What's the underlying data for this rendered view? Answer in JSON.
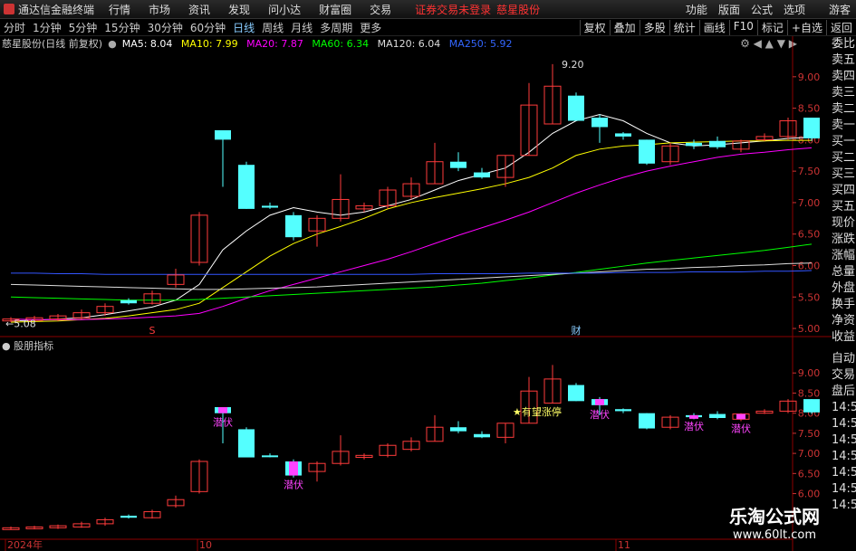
{
  "menubar": {
    "app_title": "通达信金融终端",
    "menus": [
      "行情",
      "市场",
      "资讯",
      "发现",
      "问小达",
      "财富圈",
      "交易"
    ],
    "warning": "证券交易未登录",
    "stock_name": "慈星股份",
    "right_menus": [
      "功能",
      "版面",
      "公式",
      "选项"
    ],
    "user": "游客"
  },
  "periods": {
    "items": [
      "分时",
      "1分钟",
      "5分钟",
      "15分钟",
      "30分钟",
      "60分钟",
      "日线",
      "周线",
      "月线",
      "多周期",
      "更多"
    ],
    "active": "日线",
    "tools": [
      "复权",
      "叠加",
      "多股",
      "统计",
      "画线",
      "F10",
      "标记",
      "+自选",
      "返回"
    ]
  },
  "title": {
    "stock": "慈星股份(日线 前复权)",
    "ma": [
      {
        "label": "MA5: 8.04",
        "color": "#ffffff"
      },
      {
        "label": "MA10: 7.99",
        "color": "#ffff00"
      },
      {
        "label": "MA20: 7.87",
        "color": "#ff00ff"
      },
      {
        "label": "MA60: 6.34",
        "color": "#00ff00"
      },
      {
        "label": "MA120: 6.04",
        "color": "#dddddd"
      },
      {
        "label": "MA250: 5.92",
        "color": "#3355ff"
      }
    ]
  },
  "right_panel": {
    "top": [
      "委比",
      "卖五",
      "卖四",
      "卖三",
      "卖二",
      "卖一",
      "买一",
      "买二",
      "买三",
      "买四",
      "买五",
      "现价",
      "涨跌",
      "涨幅",
      "总量",
      "外盘",
      "换手",
      "净资",
      "收益"
    ],
    "bottom": [
      "自动",
      "交易",
      "盘后",
      "14:56",
      "14:56",
      "14:56",
      "14:56",
      "14:56",
      "14:56",
      "14:56"
    ]
  },
  "main_axis": {
    "ticks": [
      "9.00",
      "8.50",
      "8.00",
      "7.50",
      "7.00",
      "6.50",
      "6.00",
      "5.50",
      "5.00"
    ]
  },
  "sub_axis": {
    "ticks": [
      "9.00",
      "8.50",
      "8.00",
      "7.50",
      "7.00",
      "6.50",
      "6.00"
    ]
  },
  "annotations": {
    "high": "9.20",
    "low": "5.08",
    "marker_s": "S",
    "marker_cai": "财",
    "ambush": "潜伏",
    "hope": "★有望涨停"
  },
  "sub_indicator": "股朋指标",
  "date_axis": [
    "2024年",
    "10",
    "11"
  ],
  "watermark": {
    "big": "乐淘公式网",
    "small": "www.60lt.com"
  },
  "chart_data": {
    "type": "candlestick",
    "title": "慈星股份(日线 前复权)",
    "candles": [
      {
        "o": 5.12,
        "c": 5.15,
        "h": 5.18,
        "l": 5.1
      },
      {
        "o": 5.13,
        "c": 5.17,
        "h": 5.2,
        "l": 5.11
      },
      {
        "o": 5.15,
        "c": 5.2,
        "h": 5.23,
        "l": 5.12
      },
      {
        "o": 5.17,
        "c": 5.25,
        "h": 5.3,
        "l": 5.15
      },
      {
        "o": 5.25,
        "c": 5.35,
        "h": 5.4,
        "l": 5.2
      },
      {
        "o": 5.4,
        "c": 5.45,
        "h": 5.48,
        "l": 5.38,
        "up": false
      },
      {
        "o": 5.4,
        "c": 5.55,
        "h": 5.6,
        "l": 5.38
      },
      {
        "o": 5.7,
        "c": 5.85,
        "h": 5.95,
        "l": 5.65
      },
      {
        "o": 6.05,
        "c": 6.8,
        "h": 6.85,
        "l": 6.0
      },
      {
        "o": 8.15,
        "c": 8.0,
        "h": 8.15,
        "l": 7.25,
        "up": false
      },
      {
        "o": 7.6,
        "c": 6.9,
        "h": 7.65,
        "l": 6.9,
        "up": false
      },
      {
        "o": 6.95,
        "c": 6.92,
        "h": 7.0,
        "l": 6.9,
        "up": false
      },
      {
        "o": 6.8,
        "c": 6.45,
        "h": 6.85,
        "l": 6.4,
        "up": false
      },
      {
        "o": 6.55,
        "c": 6.75,
        "h": 6.8,
        "l": 6.3
      },
      {
        "o": 6.75,
        "c": 7.05,
        "h": 7.45,
        "l": 6.7
      },
      {
        "o": 6.9,
        "c": 6.95,
        "h": 7.0,
        "l": 6.85
      },
      {
        "o": 6.95,
        "c": 7.2,
        "h": 7.25,
        "l": 6.9
      },
      {
        "o": 7.1,
        "c": 7.3,
        "h": 7.4,
        "l": 7.05
      },
      {
        "o": 7.3,
        "c": 7.65,
        "h": 7.95,
        "l": 7.3
      },
      {
        "o": 7.65,
        "c": 7.55,
        "h": 7.8,
        "l": 7.5,
        "up": false
      },
      {
        "o": 7.48,
        "c": 7.4,
        "h": 7.55,
        "l": 7.38,
        "up": false
      },
      {
        "o": 7.4,
        "c": 7.75,
        "h": 7.75,
        "l": 7.25
      },
      {
        "o": 7.75,
        "c": 8.55,
        "h": 8.9,
        "l": 7.75
      },
      {
        "o": 8.25,
        "c": 8.85,
        "h": 9.2,
        "l": 8.25
      },
      {
        "o": 8.7,
        "c": 8.3,
        "h": 8.75,
        "l": 8.3,
        "up": false
      },
      {
        "o": 8.35,
        "c": 8.2,
        "h": 8.4,
        "l": 7.95,
        "up": false
      },
      {
        "o": 8.1,
        "c": 8.05,
        "h": 8.12,
        "l": 8.0
      },
      {
        "o": 8.0,
        "c": 7.62,
        "h": 8.0,
        "l": 7.6,
        "up": false
      },
      {
        "o": 7.65,
        "c": 7.9,
        "h": 7.95,
        "l": 7.6
      },
      {
        "o": 7.95,
        "c": 7.9,
        "h": 8.0,
        "l": 7.85,
        "up": false
      },
      {
        "o": 7.98,
        "c": 7.88,
        "h": 8.05,
        "l": 7.85,
        "up": false
      },
      {
        "o": 7.85,
        "c": 7.98,
        "h": 8.0,
        "l": 7.8
      },
      {
        "o": 8.0,
        "c": 8.05,
        "h": 8.1,
        "l": 7.98
      },
      {
        "o": 8.05,
        "c": 8.3,
        "h": 8.35,
        "l": 8.0
      },
      {
        "o": 8.35,
        "c": 8.02,
        "h": 8.35,
        "l": 7.98,
        "up": false
      }
    ],
    "ma_series": [
      {
        "name": "MA5",
        "values": [
          5.12,
          5.13,
          5.15,
          5.17,
          5.22,
          5.28,
          5.34,
          5.45,
          5.7,
          6.25,
          6.55,
          6.8,
          6.92,
          6.85,
          6.8,
          6.85,
          6.95,
          7.05,
          7.2,
          7.35,
          7.45,
          7.55,
          7.8,
          8.1,
          8.3,
          8.4,
          8.3,
          8.1,
          7.95,
          7.9,
          7.92,
          7.95,
          7.98,
          8.02,
          8.04
        ],
        "color": "#ffffff"
      },
      {
        "name": "MA10",
        "values": [
          5.1,
          5.11,
          5.12,
          5.14,
          5.16,
          5.2,
          5.25,
          5.3,
          5.4,
          5.65,
          5.9,
          6.15,
          6.35,
          6.5,
          6.62,
          6.75,
          6.9,
          7.0,
          7.08,
          7.15,
          7.22,
          7.3,
          7.4,
          7.55,
          7.75,
          7.85,
          7.9,
          7.92,
          7.95,
          7.96,
          7.97,
          7.98,
          7.98,
          7.99,
          7.99
        ],
        "color": "#ffff00"
      },
      {
        "name": "MA20",
        "values": [
          5.15,
          5.14,
          5.14,
          5.14,
          5.15,
          5.16,
          5.18,
          5.2,
          5.24,
          5.35,
          5.48,
          5.6,
          5.7,
          5.8,
          5.9,
          6.0,
          6.1,
          6.22,
          6.35,
          6.48,
          6.6,
          6.72,
          6.85,
          7.0,
          7.15,
          7.28,
          7.4,
          7.5,
          7.58,
          7.65,
          7.72,
          7.77,
          7.8,
          7.84,
          7.87
        ],
        "color": "#ff00ff"
      },
      {
        "name": "MA60",
        "values": [
          5.5,
          5.49,
          5.48,
          5.47,
          5.46,
          5.45,
          5.45,
          5.45,
          5.46,
          5.48,
          5.5,
          5.52,
          5.54,
          5.56,
          5.58,
          5.6,
          5.62,
          5.64,
          5.66,
          5.69,
          5.72,
          5.76,
          5.8,
          5.85,
          5.89,
          5.94,
          5.99,
          6.04,
          6.08,
          6.12,
          6.16,
          6.2,
          6.24,
          6.29,
          6.34
        ],
        "color": "#00ff00"
      },
      {
        "name": "MA120",
        "values": [
          5.7,
          5.69,
          5.68,
          5.67,
          5.66,
          5.65,
          5.64,
          5.63,
          5.62,
          5.62,
          5.63,
          5.64,
          5.65,
          5.66,
          5.68,
          5.7,
          5.72,
          5.74,
          5.76,
          5.78,
          5.8,
          5.82,
          5.84,
          5.86,
          5.88,
          5.9,
          5.92,
          5.94,
          5.95,
          5.97,
          5.98,
          6.0,
          6.01,
          6.03,
          6.04
        ],
        "color": "#dddddd"
      },
      {
        "name": "MA250",
        "values": [
          5.88,
          5.88,
          5.87,
          5.87,
          5.86,
          5.86,
          5.86,
          5.86,
          5.86,
          5.86,
          5.86,
          5.86,
          5.86,
          5.86,
          5.86,
          5.86,
          5.86,
          5.86,
          5.87,
          5.87,
          5.87,
          5.87,
          5.88,
          5.88,
          5.88,
          5.88,
          5.89,
          5.89,
          5.89,
          5.9,
          5.9,
          5.9,
          5.91,
          5.91,
          5.92
        ],
        "color": "#3355ff"
      }
    ],
    "ylim": [
      4.9,
      9.4
    ],
    "sub_ylim": [
      5.0,
      9.5
    ],
    "ambush_days": [
      9,
      12,
      25,
      29,
      31
    ],
    "hope_day": 21
  }
}
